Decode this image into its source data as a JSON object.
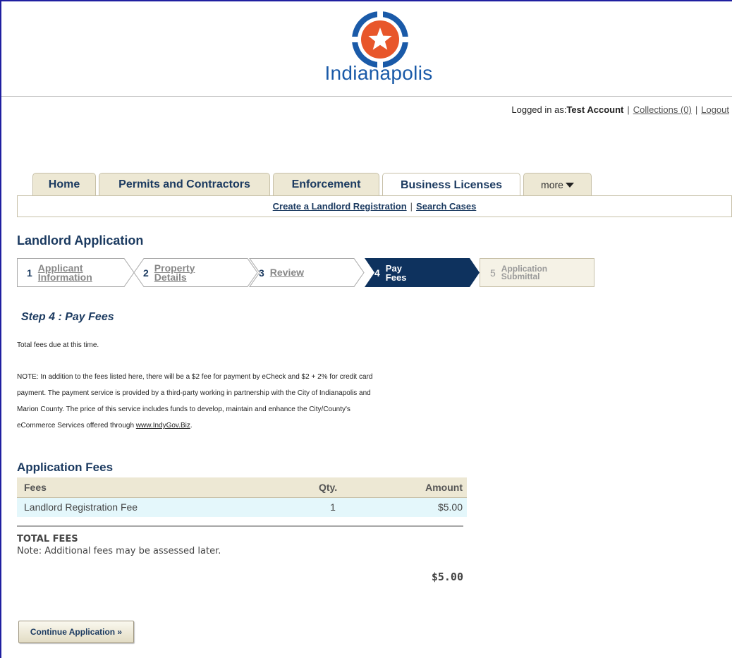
{
  "brand": {
    "logo_text": "Indianapolis",
    "colors": {
      "orange": "#e8562a",
      "blue": "#1a5aa8",
      "navy": "#0e325e"
    }
  },
  "userbar": {
    "logged_in_prefix": "Logged in as:",
    "user_name": "Test Account",
    "collections": "Collections (0)",
    "logout": "Logout"
  },
  "tabs": [
    {
      "label": "Home"
    },
    {
      "label": "Permits and Contractors"
    },
    {
      "label": "Enforcement"
    },
    {
      "label": "Business Licenses",
      "active": true
    },
    {
      "label": "more"
    }
  ],
  "subnav": {
    "create": "Create a Landlord Registration",
    "search": "Search Cases"
  },
  "page_title": "Landlord Application",
  "steps": [
    {
      "num": "1",
      "label_line1": "Applicant",
      "label_line2": "Information",
      "state": "completed"
    },
    {
      "num": "2",
      "label": "Property Details",
      "state": "completed"
    },
    {
      "num": "3",
      "label": "Review",
      "state": "completed"
    },
    {
      "num": "4",
      "label": "Pay Fees",
      "state": "active"
    },
    {
      "num": "5",
      "label_line1": "Application",
      "label_line2": "Submittal",
      "state": "future"
    }
  ],
  "step_heading": "Step 4 : Pay Fees",
  "intro_text": "Total fees due at this time.",
  "note_lines": [
    "NOTE: In addition to the fees listed here, there will be a $2 fee for payment by eCheck and $2 + 2% for credit card",
    "payment. The payment service is provided by a third-party working in partnership with the City of Indianapolis and",
    "Marion County. The price of this service includes funds to develop, maintain and enhance the City/County's"
  ],
  "note_last_prefix": "eCommerce Services offered through ",
  "note_link": "www.IndyGov.Biz",
  "note_last_suffix": ".",
  "fees": {
    "title": "Application Fees",
    "columns": {
      "fee": "Fees",
      "qty": "Qty.",
      "amount": "Amount"
    },
    "rows": [
      {
        "fee": "Landlord Registration Fee",
        "qty": "1",
        "amount": "$5.00"
      }
    ],
    "total_label": "TOTAL FEES",
    "total_note": "Note: Additional fees may be assessed later.",
    "total_amount": "$5.00"
  },
  "continue_button": "Continue Application »"
}
